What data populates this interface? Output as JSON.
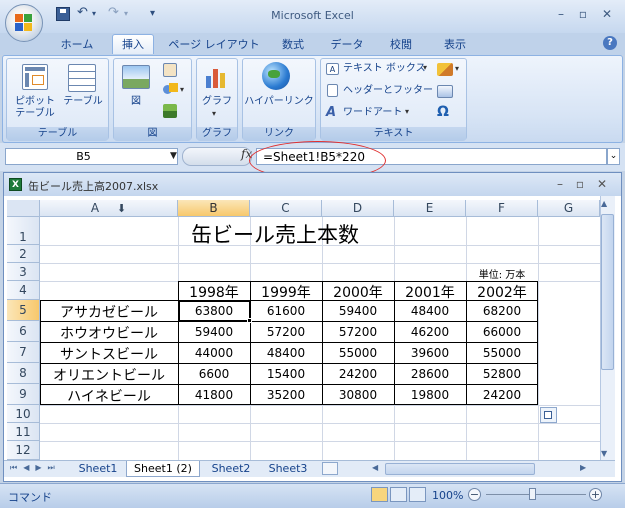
{
  "window": {
    "title": "Microsoft Excel"
  },
  "ribbon_tabs": [
    "ホーム",
    "挿入",
    "ページ レイアウト",
    "数式",
    "データ",
    "校閲",
    "表示"
  ],
  "active_tab": "挿入",
  "ribbon": {
    "groups": {
      "table": {
        "label": "テーブル",
        "pivot": "ピボット\nテーブル",
        "table_btn": "テーブル"
      },
      "illustrations": {
        "label": "図",
        "picture": "図"
      },
      "charts": {
        "label": "グラフ",
        "graph": "グラフ"
      },
      "links": {
        "label": "リンク",
        "hyperlink": "ハイパーリンク"
      },
      "text": {
        "label": "テキスト",
        "textbox": "テキスト ボックス",
        "header_footer": "ヘッダーとフッター",
        "wordart": "ワードアート"
      }
    }
  },
  "formula_bar": {
    "name_box": "B5",
    "fx": "fx",
    "formula": "=Sheet1!B5*220"
  },
  "workbook": {
    "title": "缶ビール売上高2007.xlsx"
  },
  "columns": [
    "A",
    "B",
    "C",
    "D",
    "E",
    "F",
    "G"
  ],
  "rows": [
    "1",
    "2",
    "3",
    "4",
    "5",
    "6",
    "7",
    "8",
    "9",
    "10",
    "11",
    "12"
  ],
  "sheet": {
    "title": "缶ビール売上本数",
    "unit": "単位: 万本",
    "years": [
      "1998年",
      "1999年",
      "2000年",
      "2001年",
      "2002年"
    ],
    "data": [
      {
        "name": "アサカゼビール",
        "values": [
          "63800",
          "61600",
          "59400",
          "48400",
          "68200"
        ]
      },
      {
        "name": "ホウオウビール",
        "values": [
          "59400",
          "57200",
          "57200",
          "46200",
          "66000"
        ]
      },
      {
        "name": "サントスビール",
        "values": [
          "44000",
          "48400",
          "55000",
          "39600",
          "55000"
        ]
      },
      {
        "name": "オリエントビール",
        "values": [
          "6600",
          "15400",
          "24200",
          "28600",
          "52800"
        ]
      },
      {
        "name": "ハイネビール",
        "values": [
          "41800",
          "35200",
          "30800",
          "19800",
          "24200"
        ]
      }
    ]
  },
  "sheet_tabs": [
    "Sheet1",
    "Sheet1 (2)",
    "Sheet2",
    "Sheet3"
  ],
  "active_sheet": "Sheet1 (2)",
  "status": {
    "mode": "コマンド",
    "zoom": "100%"
  }
}
